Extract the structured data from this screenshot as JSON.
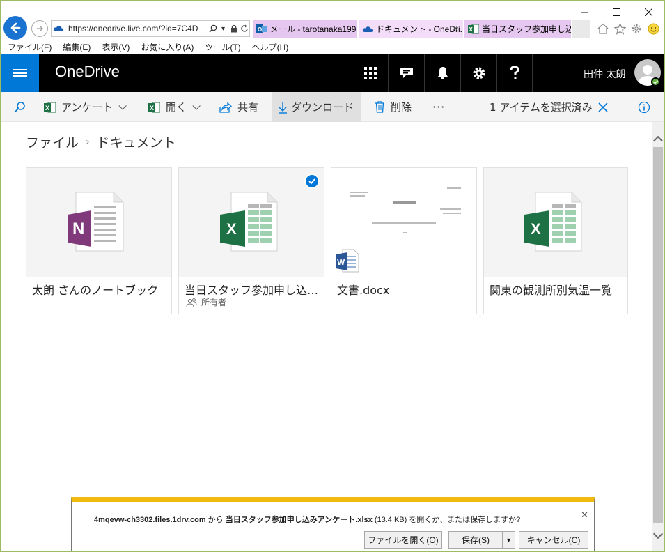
{
  "browser": {
    "url": "https://onedrive.live.com/?id=7C4D",
    "tabs": [
      {
        "label": "メール - tarotanaka199..."
      },
      {
        "label": "ドキュメント - OneDri..."
      },
      {
        "label": "当日スタッフ参加申し込..."
      }
    ],
    "menu": [
      "ファイル(F)",
      "編集(E)",
      "表示(V)",
      "お気に入り(A)",
      "ツール(T)",
      "ヘルプ(H)"
    ]
  },
  "header": {
    "app_title": "OneDrive",
    "user_name": "田仲 太朗",
    "colors": {
      "waffle": "#0078d7",
      "bar": "#000000"
    }
  },
  "commands": {
    "survey": "アンケート",
    "open": "開く",
    "share": "共有",
    "download": "ダウンロード",
    "delete": "削除",
    "more": "···",
    "selection": "1 アイテムを選択済み"
  },
  "breadcrumb": {
    "root": "ファイル",
    "current": "ドキュメント"
  },
  "files": [
    {
      "name": "太朗 さんのノートブック",
      "type": "onenote",
      "meta": ""
    },
    {
      "name": "当日スタッフ参加申し込みアンケート",
      "type": "excel",
      "meta": "所有者",
      "selected": true
    },
    {
      "name": "文書.docx",
      "type": "word",
      "meta": ""
    },
    {
      "name": "関東の観測所別気温一覧",
      "type": "excel",
      "meta": ""
    }
  ],
  "download_prompt": {
    "host": "4mqevw-ch3302.files.1drv.com",
    "from": " から ",
    "filename": "当日スタッフ参加申し込みアンケート.xlsx",
    "size": " (13.4 KB) ",
    "question": "を開くか、または保存しますか?",
    "open_label": "ファイルを開く(O)",
    "save_label": "保存(S)",
    "cancel_label": "キャンセル(C)"
  }
}
